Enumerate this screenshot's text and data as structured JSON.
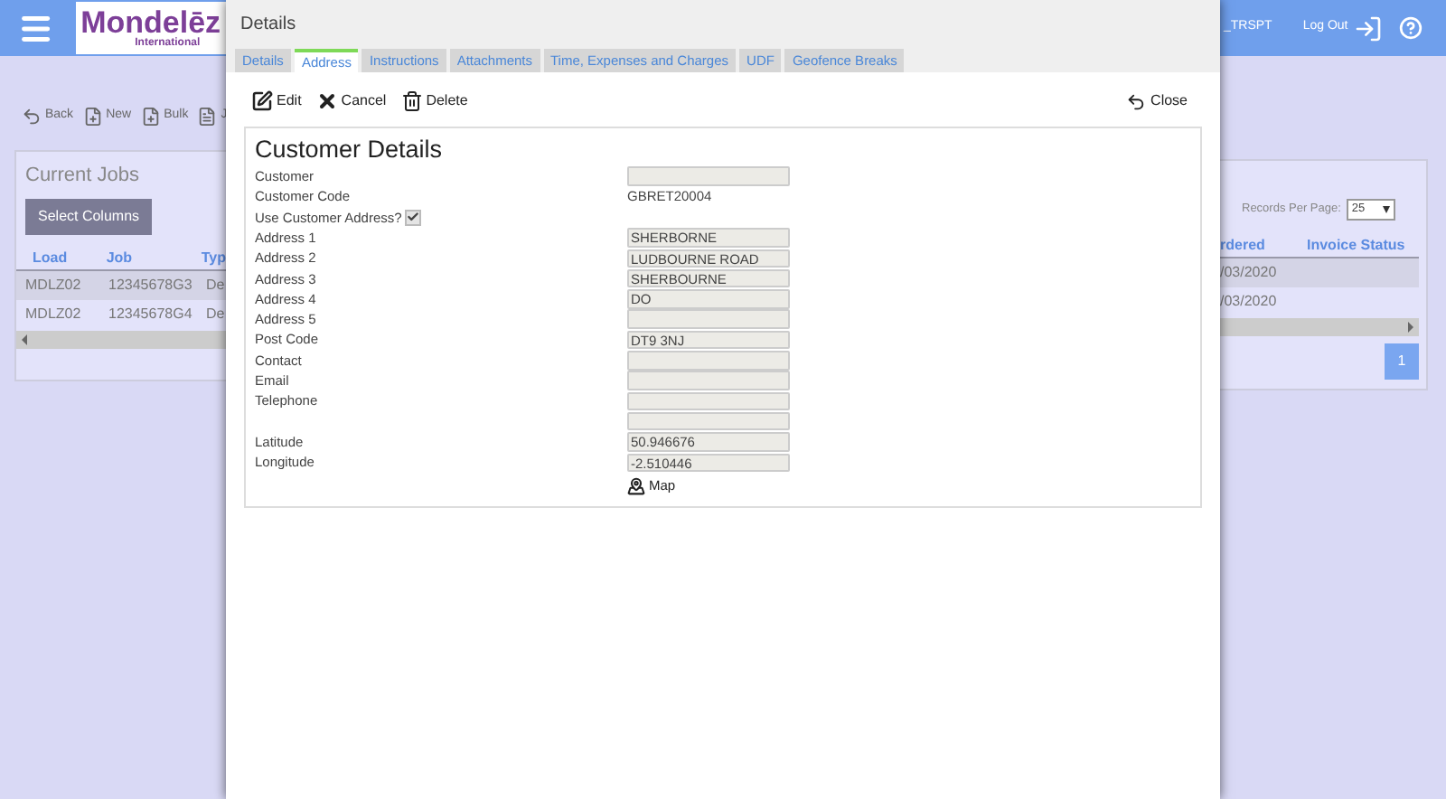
{
  "app": {
    "logo": {
      "name": "Mondelēz",
      "sub": "International"
    },
    "user": "_TRSPT",
    "logout": "Log Out",
    "toolbar": [
      {
        "kind": "back",
        "label": "Back"
      },
      {
        "kind": "new",
        "label": "New"
      },
      {
        "kind": "bulk",
        "label": "Bulk"
      },
      {
        "kind": "list",
        "label": "J"
      }
    ],
    "jobs": {
      "title": "Current Jobs",
      "select_columns": "Select Columns",
      "records_label": "Records Per Page:",
      "records_value": "25",
      "columns_left": [
        "Load",
        "Job",
        "Typ"
      ],
      "columns_right": [
        "rdered",
        "Invoice Status"
      ],
      "rows": [
        {
          "left": [
            "MDLZ02",
            "12345678G3",
            "De"
          ],
          "right": [
            "/03/2020"
          ]
        },
        {
          "left": [
            "MDLZ02",
            "12345678G4",
            "De"
          ],
          "right": [
            "/03/2020"
          ]
        }
      ],
      "pages": [
        {
          "label": "1",
          "selected": true
        }
      ]
    }
  },
  "dialog": {
    "title": "Details",
    "tabs": [
      {
        "label": "Details",
        "selected": false
      },
      {
        "label": "Address",
        "selected": true
      },
      {
        "label": "Instructions",
        "selected": false
      },
      {
        "label": "Attachments",
        "selected": false
      },
      {
        "label": "Time, Expenses and Charges",
        "selected": false
      },
      {
        "label": "UDF",
        "selected": false
      },
      {
        "label": "Geofence Breaks",
        "selected": false
      }
    ],
    "actions": [
      {
        "kind": "edit",
        "label": "Edit"
      },
      {
        "kind": "cancel",
        "label": "Cancel"
      },
      {
        "kind": "delete",
        "label": "Delete"
      }
    ],
    "close": "Close",
    "section_title": "Customer Details",
    "rows": [
      {
        "kind": "field",
        "label": "Customer"
      },
      {
        "kind": "text",
        "label": "Customer Code",
        "value": "GBRET20004"
      },
      {
        "kind": "checkbox",
        "label": "Use Customer Address?",
        "checked": true
      },
      {
        "kind": "field",
        "label": "Address 1",
        "value": "SHERBORNE"
      },
      {
        "kind": "field",
        "label": "Address 2",
        "value": "LUDBOURNE ROAD"
      },
      {
        "kind": "field",
        "label": "Address 3",
        "value": "SHERBOURNE"
      },
      {
        "kind": "field",
        "label": "Address 4",
        "value": "DO"
      },
      {
        "kind": "field",
        "label": "Address 5"
      },
      {
        "kind": "field",
        "label": "Post Code",
        "value": "DT9 3NJ"
      },
      {
        "kind": "field",
        "label": "Contact"
      },
      {
        "kind": "field",
        "label": "Email"
      },
      {
        "kind": "field",
        "label": "Telephone"
      },
      {
        "kind": "field"
      },
      {
        "kind": "field",
        "label": "Latitude",
        "value": "50.946676"
      },
      {
        "kind": "field",
        "label": "Longitude",
        "value": "-2.510446"
      }
    ],
    "map": "Map"
  }
}
